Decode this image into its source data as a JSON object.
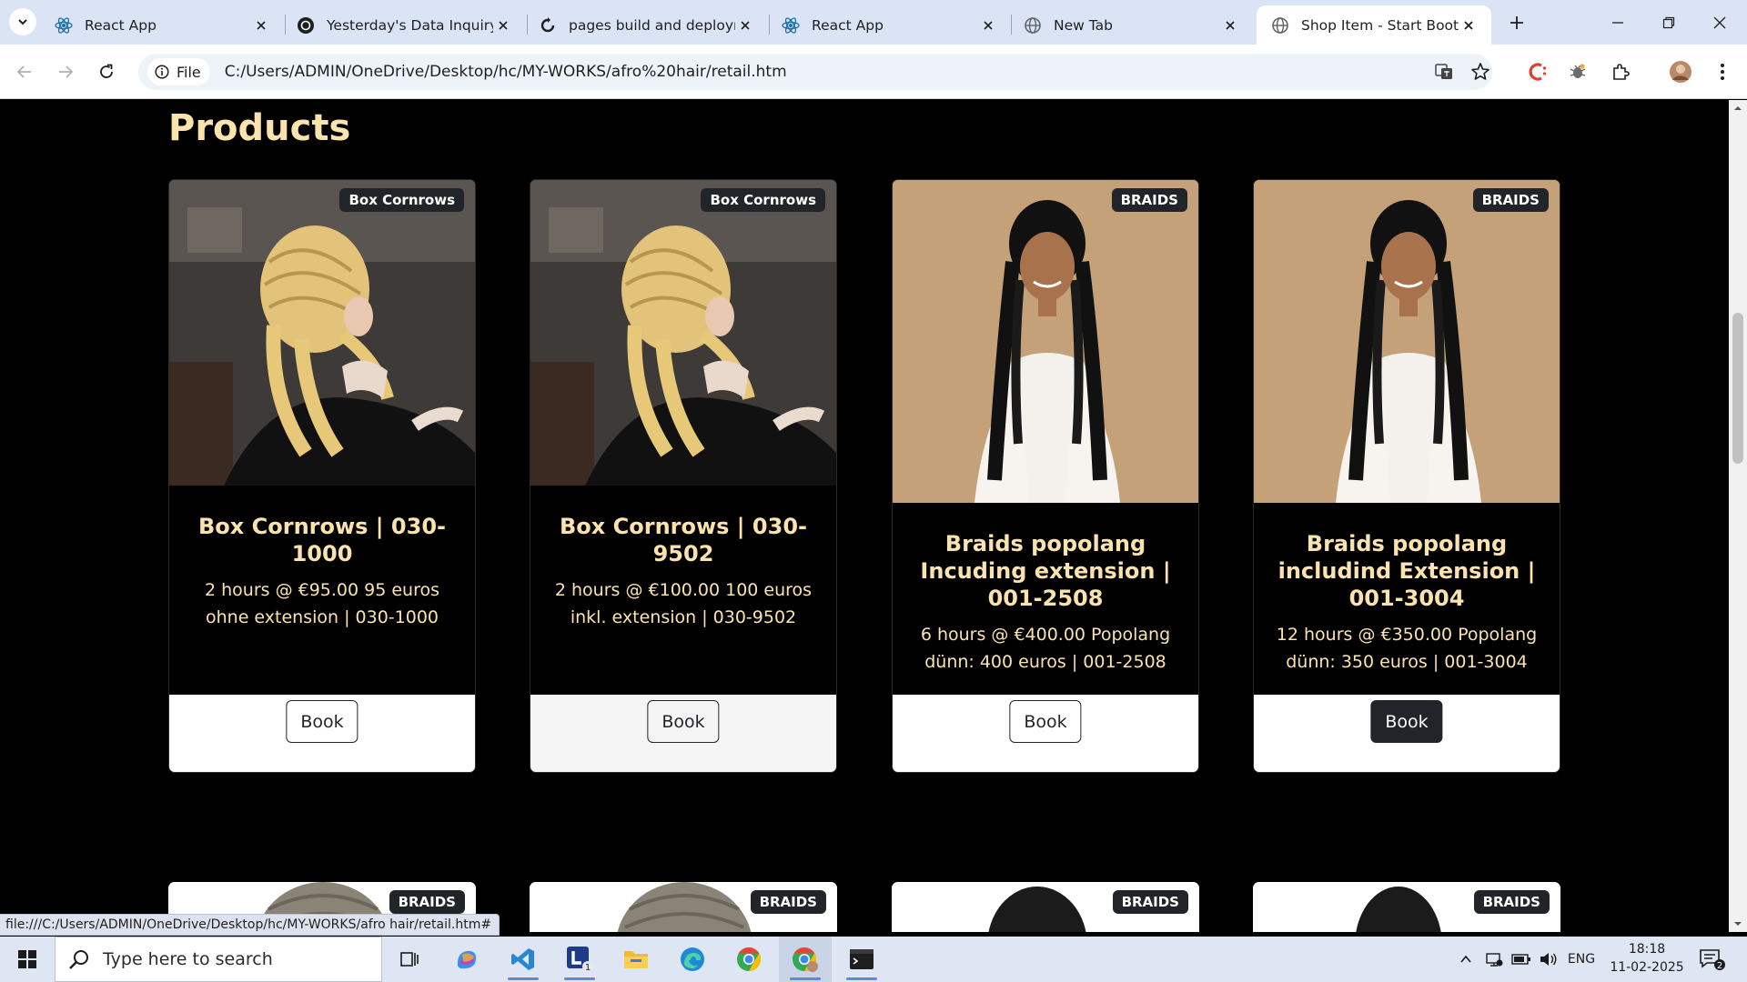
{
  "browser": {
    "tabs": [
      {
        "title": "React App",
        "icon": "react-icon"
      },
      {
        "title": "Yesterday's Data Inquiry",
        "icon": "chatgpt-icon"
      },
      {
        "title": "pages build and deployme",
        "icon": "github-icon"
      },
      {
        "title": "React App",
        "icon": "react-icon"
      },
      {
        "title": "New Tab",
        "icon": "globe-icon"
      },
      {
        "title": "Shop Item - Start Bootstra",
        "icon": "globe-icon",
        "active": true
      }
    ],
    "address": {
      "chip_label": "File",
      "url": "C:/Users/ADMIN/OneDrive/Desktop/hc/MY-WORKS/afro%20hair/retail.htm"
    }
  },
  "page": {
    "heading": "Products",
    "book_label": "Book",
    "products": [
      {
        "badge": "Box Cornrows",
        "title": "Box Cornrows | 030-1000",
        "desc": "2 hours @ €95.00 95 euros ohne extension | 030-1000",
        "image": "blonde-cornrows-photo"
      },
      {
        "badge": "Box Cornrows",
        "title": "Box Cornrows | 030-9502",
        "desc": "2 hours @ €100.00 100 euros inkl. extension | 030-9502",
        "image": "blonde-cornrows-photo"
      },
      {
        "badge": "BRAIDS",
        "title": "Braids popolang Incuding extension | 001-2508",
        "desc": "6 hours @ €400.00 Popolang dünn: 400 euros | 001-2508",
        "image": "long-braids-photo"
      },
      {
        "badge": "BRAIDS",
        "title": "Braids popolang includind Extension | 001-3004",
        "desc": "12 hours @ €350.00 Popolang dünn: 350 euros | 001-3004",
        "image": "long-braids-photo"
      }
    ],
    "next_row_badges": [
      "BRAIDS",
      "BRAIDS",
      "BRAIDS",
      "BRAIDS"
    ]
  },
  "status_bar": {
    "text": "file:///C:/Users/ADMIN/OneDrive/Desktop/hc/MY-WORKS/afro hair/retail.htm#"
  },
  "taskbar": {
    "search_placeholder": "Type here to search",
    "lang": "ENG",
    "time": "18:18",
    "date": "11-02-2025",
    "notification_count": "2",
    "app_badge": "1"
  },
  "colors": {
    "accent_text": "#fbe3ae",
    "page_bg": "#000000",
    "badge_bg": "#212529"
  }
}
